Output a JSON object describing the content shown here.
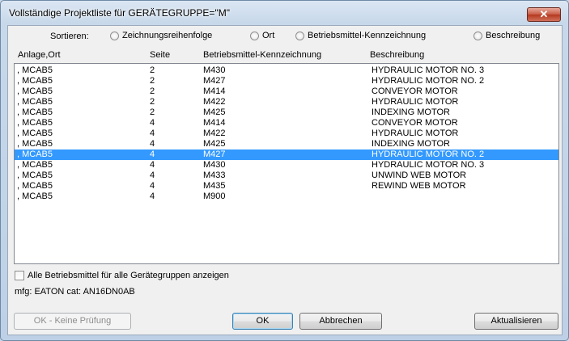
{
  "window": {
    "title": "Vollständige Projektliste für GERÄTEGRUPPE=\"M\"",
    "close_label": "✕"
  },
  "sort": {
    "label": "Sortieren:",
    "options": [
      "Zeichnungsreihenfolge",
      "Ort",
      "Betriebsmittel-Kennzeichnung",
      "Beschreibung"
    ]
  },
  "columns": [
    "Anlage,Ort",
    "Seite",
    "Betriebsmittel-Kennzeichnung",
    "Beschreibung"
  ],
  "rows": [
    {
      "ort": ", MCAB5",
      "seite": "2",
      "bmk": "M430",
      "desc": "HYDRAULIC MOTOR NO. 3"
    },
    {
      "ort": ", MCAB5",
      "seite": "2",
      "bmk": "M427",
      "desc": "HYDRAULIC MOTOR NO. 2"
    },
    {
      "ort": ", MCAB5",
      "seite": "2",
      "bmk": "M414",
      "desc": "CONVEYOR MOTOR"
    },
    {
      "ort": ", MCAB5",
      "seite": "2",
      "bmk": "M422",
      "desc": "HYDRAULIC MOTOR"
    },
    {
      "ort": ", MCAB5",
      "seite": "2",
      "bmk": "M425",
      "desc": "INDEXING MOTOR"
    },
    {
      "ort": ", MCAB5",
      "seite": "4",
      "bmk": "M414",
      "desc": "CONVEYOR MOTOR"
    },
    {
      "ort": ", MCAB5",
      "seite": "4",
      "bmk": "M422",
      "desc": "HYDRAULIC MOTOR"
    },
    {
      "ort": ", MCAB5",
      "seite": "4",
      "bmk": "M425",
      "desc": "INDEXING MOTOR"
    },
    {
      "ort": ", MCAB5",
      "seite": "4",
      "bmk": "M427",
      "desc": "HYDRAULIC MOTOR NO. 2"
    },
    {
      "ort": ", MCAB5",
      "seite": "4",
      "bmk": "M430",
      "desc": "HYDRAULIC MOTOR NO. 3"
    },
    {
      "ort": ", MCAB5",
      "seite": "4",
      "bmk": "M433",
      "desc": "UNWIND WEB MOTOR"
    },
    {
      "ort": ", MCAB5",
      "seite": "4",
      "bmk": "M435",
      "desc": "REWIND WEB MOTOR"
    },
    {
      "ort": ", MCAB5",
      "seite": "4",
      "bmk": "M900",
      "desc": ""
    }
  ],
  "selected_row": 8,
  "show_all_checkbox": {
    "label": "Alle Betriebsmittel für alle Gerätegruppen anzeigen",
    "checked": false
  },
  "info_text": "mfg: EATON  cat: AN16DN0AB",
  "buttons": {
    "no_check": "OK - Keine Prüfung",
    "ok": "OK",
    "cancel": "Abbrechen",
    "refresh": "Aktualisieren"
  },
  "colors": {
    "selection": "#3399ff"
  }
}
